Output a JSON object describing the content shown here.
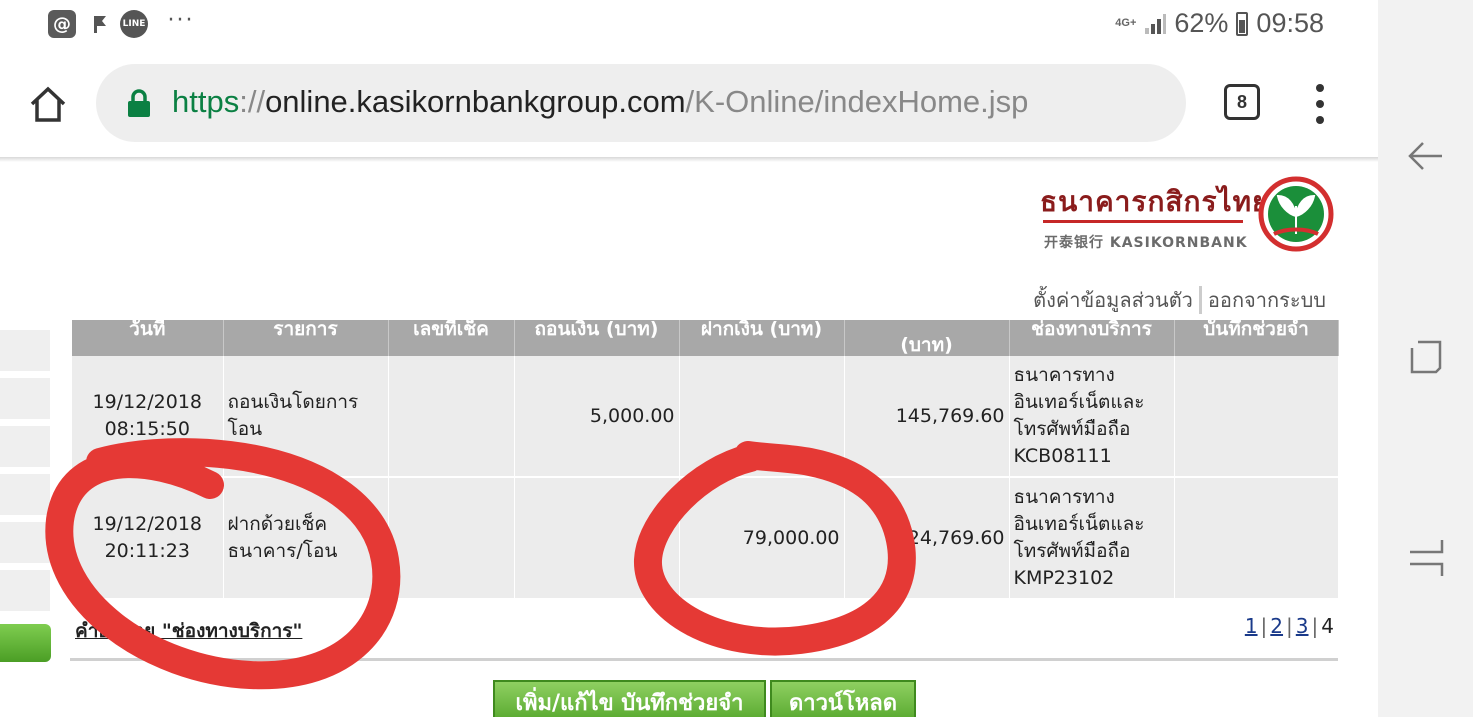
{
  "status_bar": {
    "network": "4G+",
    "battery": "62%",
    "battery_level": 0.62,
    "time": "09:58",
    "icons": [
      "at-sign-icon",
      "flag-icon",
      "line-app-icon",
      "more-dots-icon",
      "signal-icon",
      "battery-icon"
    ]
  },
  "browser": {
    "url_scheme": "https",
    "url_sep": "://",
    "url_host": "online.kasikornbankgroup.com",
    "url_path": "/K-Online/indexHome.jsp",
    "tab_count": "8",
    "icons": [
      "home-icon",
      "lock-icon",
      "tabs-icon",
      "menu-dots-icon"
    ]
  },
  "logo": {
    "thai_name": "ธนาคารกสิกรไทย",
    "english_name": "开泰银行 KASIKORNBANK"
  },
  "top_links": {
    "personal_settings": "ตั้งค่าข้อมูลส่วนตัว",
    "logout": "ออกจากระบบ"
  },
  "table": {
    "headers": [
      "วันที่",
      "รายการ",
      "เลขที่เช็ค",
      "ถอนเงิน (บาท)",
      "ฝากเงิน (บาท)",
      "(บาท)",
      "ช่องทางบริการ",
      "บันทึกช่วยจำ"
    ],
    "rows": [
      {
        "date": "19/12/2018",
        "time": "08:15:50",
        "description": "ถอนเงินโดยการโอน",
        "cheque": "",
        "withdraw": "5,000.00",
        "deposit": "",
        "balance": "145,769.60",
        "channel": "ธนาคารทางอินเทอร์เน็ตและโทรศัพท์มือถือ KCB08111",
        "memo": ""
      },
      {
        "date": "19/12/2018",
        "time": "20:11:23",
        "description": "ฝากด้วยเช็คธนาคาร/โอน",
        "cheque": "",
        "withdraw": "",
        "deposit": "79,000.00",
        "balance": "224,769.60",
        "channel": "ธนาคารทางอินเทอร์เน็ตและโทรศัพท์มือถือ KMP23102",
        "memo": ""
      }
    ]
  },
  "help_link": "คำอธิบาย \"ช่องทางบริการ\"",
  "pagination": {
    "pages": [
      "1",
      "2",
      "3",
      "4"
    ],
    "current": "4"
  },
  "buttons": {
    "save_memo": "เพิ่ม/แก้ไข  บันทึกช่วยจำ",
    "download": "ดาวน์โหลด"
  },
  "colors": {
    "brand_green": "#0b8043",
    "header_gray": "#a8a8a8",
    "annotation_red": "#e53935",
    "button_green": "#56a72d"
  }
}
